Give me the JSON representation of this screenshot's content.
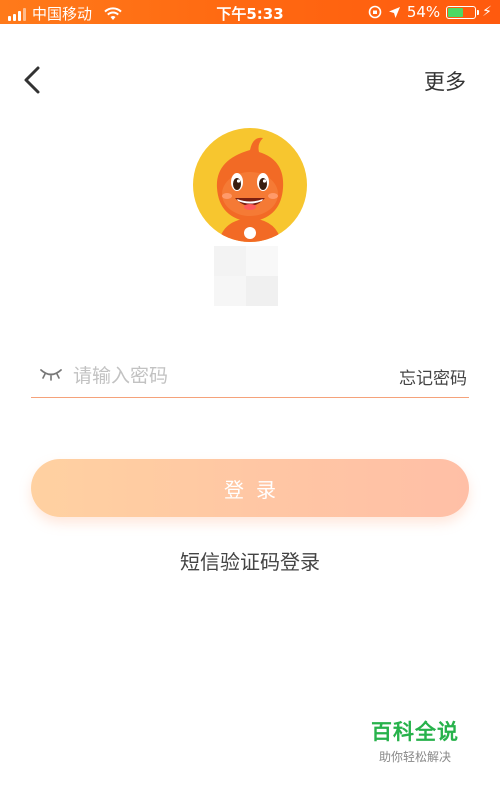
{
  "status_bar": {
    "carrier": "中国移动",
    "time": "下午5:33",
    "battery_percent": "54%",
    "battery_level": 0.54,
    "icons": [
      "signal-icon",
      "wifi-icon",
      "orientation-lock-icon",
      "location-icon",
      "battery-icon",
      "charging-icon"
    ]
  },
  "nav": {
    "back_icon": "chevron-left-icon",
    "more_label": "更多"
  },
  "login": {
    "password_placeholder": "请输入密码",
    "password_value": "",
    "eye_icon": "eye-closed-icon",
    "forgot_label": "忘记密码",
    "login_button_label": "登录",
    "sms_login_label": "短信验证码登录"
  },
  "watermark": {
    "title": "百科全说",
    "subtitle": "助你轻松解决"
  },
  "colors": {
    "status_bar": "#ff6a12",
    "accent": "#f5a27a",
    "button_start": "#ffd1a1",
    "button_end": "#ffbfa6",
    "watermark_green": "#27b24b"
  }
}
